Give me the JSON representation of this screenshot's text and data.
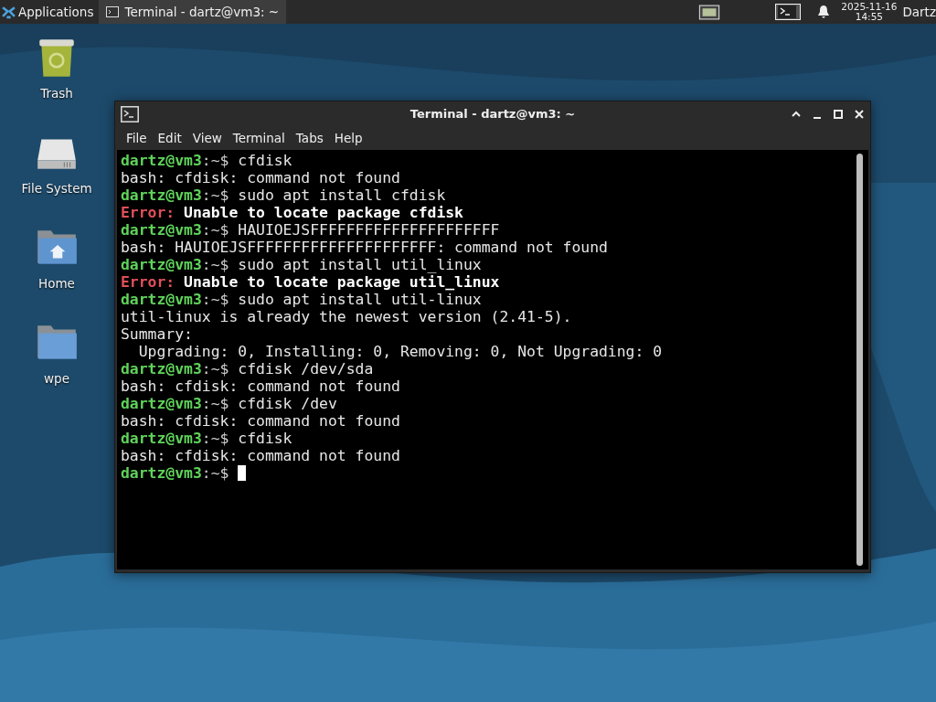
{
  "panel": {
    "menu_label": "Applications",
    "tasks": [
      {
        "label": "Terminal - dartz@vm3: ~",
        "selected": true
      }
    ],
    "date": "2025-11-16",
    "time": "14:55",
    "user": "Dartz"
  },
  "desktop_icons": [
    {
      "kind": "trash",
      "label": "Trash"
    },
    {
      "kind": "drive",
      "label": "File System"
    },
    {
      "kind": "home",
      "label": "Home"
    },
    {
      "kind": "folder",
      "label": "wpe"
    }
  ],
  "window": {
    "title": "Terminal - dartz@vm3: ~",
    "menu": [
      "File",
      "Edit",
      "View",
      "Terminal",
      "Tabs",
      "Help"
    ],
    "lines": [
      {
        "kind": "prompt",
        "host": "dartz@vm3",
        "suffix": ":~$",
        "command": "cfdisk"
      },
      {
        "kind": "output",
        "text": "bash: cfdisk: command not found"
      },
      {
        "kind": "prompt",
        "host": "dartz@vm3",
        "suffix": ":~$",
        "command": "sudo apt install cfdisk"
      },
      {
        "kind": "error",
        "label": "Error:",
        "text": "Unable to locate package cfdisk"
      },
      {
        "kind": "prompt",
        "host": "dartz@vm3",
        "suffix": ":~$",
        "command": "HAUIOEJSFFFFFFFFFFFFFFFFFFFFF"
      },
      {
        "kind": "output",
        "text": "bash: HAUIOEJSFFFFFFFFFFFFFFFFFFFFF: command not found"
      },
      {
        "kind": "prompt",
        "host": "dartz@vm3",
        "suffix": ":~$",
        "command": "sudo apt install util_linux"
      },
      {
        "kind": "error",
        "label": "Error:",
        "text": "Unable to locate package util_linux"
      },
      {
        "kind": "prompt",
        "host": "dartz@vm3",
        "suffix": ":~$",
        "command": "sudo apt install util-linux"
      },
      {
        "kind": "output",
        "text": "util-linux is already the newest version (2.41-5)."
      },
      {
        "kind": "output",
        "text": "Summary:"
      },
      {
        "kind": "output",
        "text": "  Upgrading: 0, Installing: 0, Removing: 0, Not Upgrading: 0"
      },
      {
        "kind": "prompt",
        "host": "dartz@vm3",
        "suffix": ":~$",
        "command": "cfdisk /dev/sda"
      },
      {
        "kind": "output",
        "text": "bash: cfdisk: command not found"
      },
      {
        "kind": "prompt",
        "host": "dartz@vm3",
        "suffix": ":~$",
        "command": "cfdisk /dev"
      },
      {
        "kind": "output",
        "text": "bash: cfdisk: command not found"
      },
      {
        "kind": "prompt",
        "host": "dartz@vm3",
        "suffix": ":~$",
        "command": "cfdisk"
      },
      {
        "kind": "output",
        "text": "bash: cfdisk: command not found"
      },
      {
        "kind": "prompt",
        "host": "dartz@vm3",
        "suffix": ":~$",
        "cursor": true
      }
    ]
  }
}
